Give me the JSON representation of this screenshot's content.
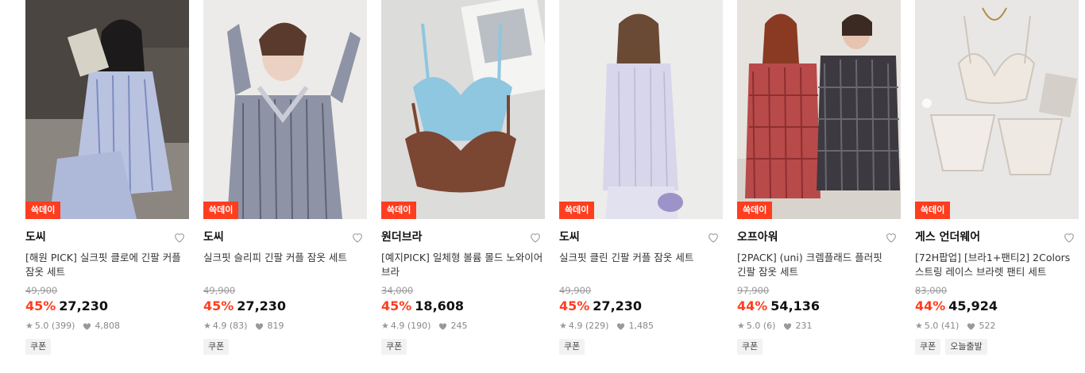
{
  "theme": {
    "badge_color": "#ff3d1f",
    "discount_color": "#ff3d1f"
  },
  "products": [
    {
      "badge": "쓱데이",
      "brand": "도씨",
      "title": "[해원 PICK] 실크핏 클로에 긴팔 커플 잠옷 세트",
      "original_price": "49,900",
      "discount": "45%",
      "price": "27,230",
      "rating": "5.0",
      "reviews": "(399)",
      "likes": "4,808",
      "tags": [
        "쿠폰"
      ],
      "image_icon": "pajama-photo"
    },
    {
      "badge": "쓱데이",
      "brand": "도씨",
      "title": "실크핏 슬리피 긴팔 커플 잠옷 세트",
      "original_price": "49,900",
      "discount": "45%",
      "price": "27,230",
      "rating": "4.9",
      "reviews": "(83)",
      "likes": "819",
      "tags": [
        "쿠폰"
      ],
      "image_icon": "pajama-photo"
    },
    {
      "badge": "쓱데이",
      "brand": "원더브라",
      "title": "[예지PICK] 일체형 볼륨 몰드 노와이어 브라",
      "original_price": "34,000",
      "discount": "45%",
      "price": "18,608",
      "rating": "4.9",
      "reviews": "(190)",
      "likes": "245",
      "tags": [
        "쿠폰"
      ],
      "image_icon": "bra-photo"
    },
    {
      "badge": "쓱데이",
      "brand": "도씨",
      "title": "실크핏 클린 긴팔 커플 잠옷 세트",
      "original_price": "49,900",
      "discount": "45%",
      "price": "27,230",
      "rating": "4.9",
      "reviews": "(229)",
      "likes": "1,485",
      "tags": [
        "쿠폰"
      ],
      "image_icon": "pajama-photo"
    },
    {
      "badge": "쓱데이",
      "brand": "오프아워",
      "title": "[2PACK] (uni) 크렘플래드 플러핏 긴팔 잠옷 세트",
      "original_price": "97,900",
      "discount": "44%",
      "price": "54,136",
      "rating": "5.0",
      "reviews": "(6)",
      "likes": "231",
      "tags": [
        "쿠폰"
      ],
      "image_icon": "couple-pajama-photo"
    },
    {
      "badge": "쓱데이",
      "brand": "게스 언더웨어",
      "title": "[72H팝업] [브라1+팬티2] 2Colors 스트링 레이스 브라렛 팬티 세트",
      "original_price": "83,000",
      "discount": "44%",
      "price": "45,924",
      "rating": "5.0",
      "reviews": "(41)",
      "likes": "522",
      "tags": [
        "쿠폰",
        "오늘출발"
      ],
      "image_icon": "lingerie-photo"
    }
  ]
}
